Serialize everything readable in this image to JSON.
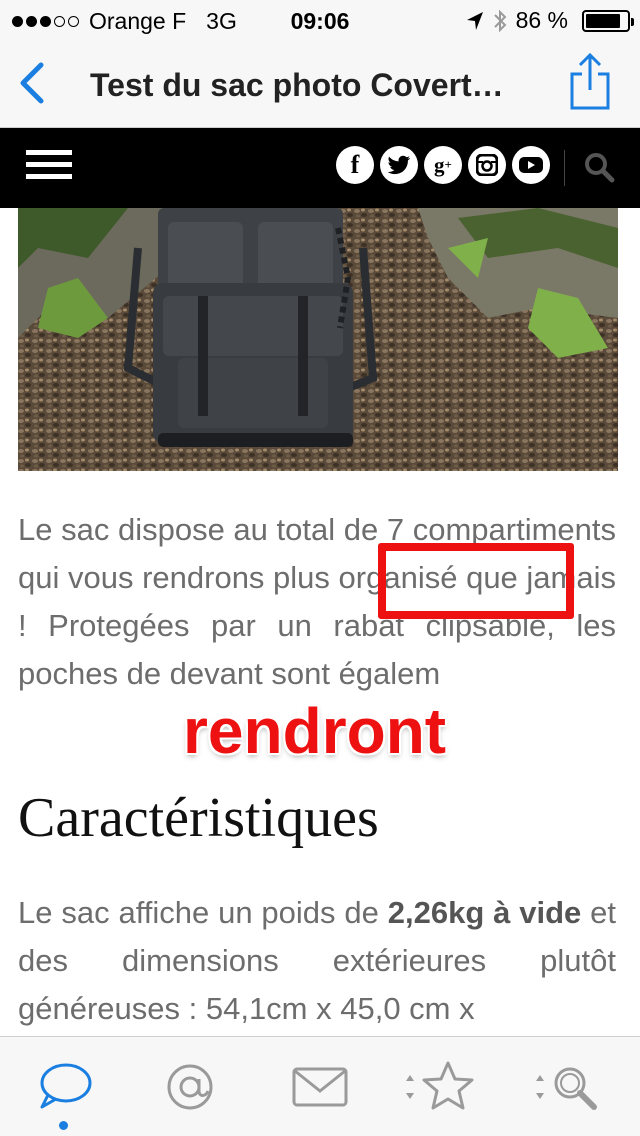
{
  "status_bar": {
    "carrier": "Orange F",
    "network": "3G",
    "time": "09:06",
    "battery": "86 %",
    "battery_level": 0.86,
    "signal_bars_filled": 3,
    "signal_bars_total": 5
  },
  "nav": {
    "title": "Test du sac photo Covert…",
    "back_icon": "chevron-left-icon",
    "share_icon": "share-icon",
    "accent_color": "#1a7fe0"
  },
  "site_header": {
    "menu_icon": "hamburger-icon",
    "social": [
      {
        "name": "facebook-icon",
        "glyph": "f"
      },
      {
        "name": "twitter-icon",
        "glyph": "t"
      },
      {
        "name": "google-plus-icon",
        "glyph": "g+"
      },
      {
        "name": "instagram-icon",
        "glyph": "ig"
      },
      {
        "name": "youtube-icon",
        "glyph": "yt"
      }
    ],
    "search_icon": "search-icon"
  },
  "article": {
    "paragraph1": "Le sac dispose au total de 7 compartiments qui vous rendrons plus organisé que jamais ! Protegées par un rabat clipsable, les poches de devant sont égalem",
    "heading": "Caractéristiques",
    "paragraph2_prefix": "Le sac affiche un poids de ",
    "paragraph2_bold": "2,26kg à vide",
    "paragraph2_suffix": " et des dimensions extérieures plutôt généreuses : 54,1cm x 45,0 cm x"
  },
  "annotation": {
    "correction": "rendront",
    "color": "#ee1111"
  },
  "tab_bar": {
    "tabs": [
      "chat-bubble-icon",
      "at-sign-icon",
      "mail-icon",
      "star-icon",
      "search-icon"
    ],
    "active_index": 0
  }
}
